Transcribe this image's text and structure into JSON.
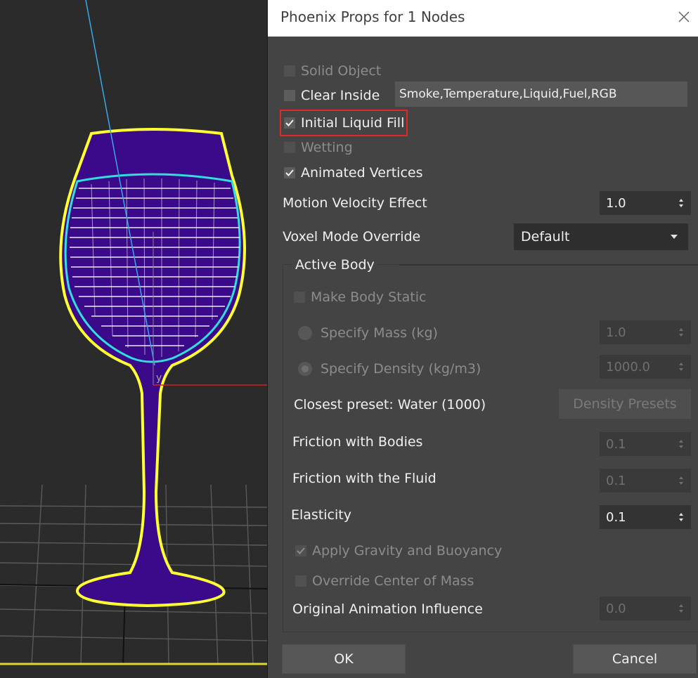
{
  "dialog": {
    "title": "Phoenix Props for 1 Nodes"
  },
  "options": {
    "solid_object": "Solid Object",
    "clear_inside": "Clear Inside",
    "clear_inside_channels": "Smoke,Temperature,Liquid,Fuel,RGB",
    "initial_liquid_fill": "Initial Liquid Fill",
    "wetting": "Wetting",
    "animated_vertices": "Animated Vertices",
    "motion_velocity_label": "Motion Velocity Effect",
    "motion_velocity_value": "1.0",
    "voxel_mode_label": "Voxel Mode Override",
    "voxel_mode_value": "Default"
  },
  "active_body": {
    "group_title": "Active Body",
    "make_body_static": "Make Body Static",
    "specify_mass_label": "Specify Mass (kg)",
    "specify_mass_value": "1.0",
    "specify_density_label": "Specify Density (kg/m3)",
    "specify_density_value": "1000.0",
    "closest_preset": "Closest preset: Water (1000)",
    "density_presets_button": "Density Presets",
    "friction_bodies_label": "Friction with Bodies",
    "friction_bodies_value": "0.1",
    "friction_fluid_label": "Friction with the Fluid",
    "friction_fluid_value": "0.1",
    "elasticity_label": "Elasticity",
    "elasticity_value": "0.1",
    "apply_gravity": "Apply Gravity and Buoyancy",
    "override_center": "Override Center of Mass",
    "original_anim_label": "Original Animation Influence",
    "original_anim_value": "0.0"
  },
  "buttons": {
    "ok": "OK",
    "cancel": "Cancel"
  },
  "viewport": {
    "axis_label": "y"
  },
  "colors": {
    "glass_outline": "#ffff33",
    "liquid_fill": "#3a0a8a",
    "liquid_outline": "#33dddd",
    "highlight": "#e02828"
  }
}
